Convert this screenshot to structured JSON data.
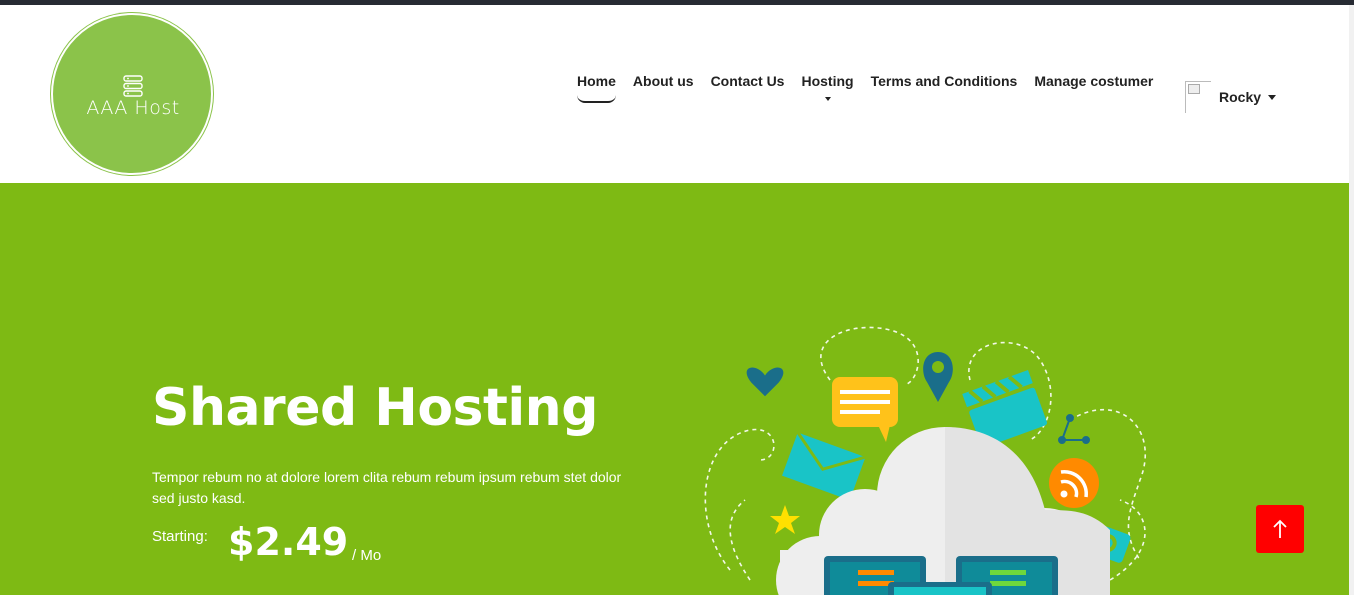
{
  "brand": {
    "logo_text": "AAA Host",
    "logo_icon": "server-icon",
    "color": "#8bc34a"
  },
  "nav": {
    "items": [
      {
        "label": "Home",
        "active": true
      },
      {
        "label": "About us"
      },
      {
        "label": "Contact Us"
      },
      {
        "label": "Hosting",
        "dropdown": true
      },
      {
        "label": "Terms and Conditions"
      },
      {
        "label": "Manage costumer"
      }
    ]
  },
  "user": {
    "name": "Rocky",
    "avatar_icon": "broken-image-icon"
  },
  "hero": {
    "title": "Shared Hosting",
    "description": "Tempor rebum no at dolore lorem clita rebum rebum ipsum rebum stet dolor sed justo kasd.",
    "starting_label": "Starting:",
    "price": "$2.49",
    "period": "/ Mo",
    "background": "#7eba14"
  },
  "back_to_top": {
    "icon": "arrow-up-icon",
    "color": "#ff0000"
  }
}
